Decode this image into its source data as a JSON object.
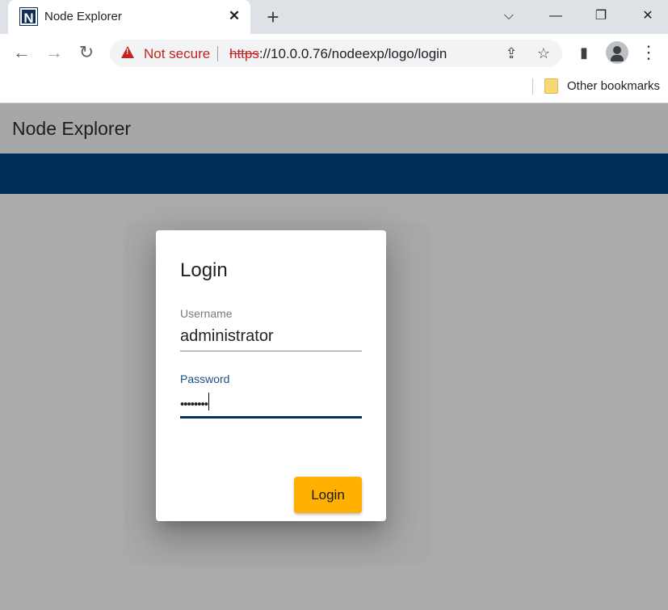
{
  "browser": {
    "tab_title": "Node Explorer",
    "favicon_letter": "N",
    "tab_close": "✕",
    "new_tab": "+",
    "security_label": "Not secure",
    "url_scheme": "https",
    "url_rest": "://10.0.0.76/nodeexp/logo/login",
    "bookmark_label": "Other bookmarks"
  },
  "icons": {
    "back": "←",
    "forward": "→",
    "reload": "↻",
    "share": "⇪",
    "star": "☆",
    "sidepanel": "▮",
    "menu": "⋮",
    "tab_search": "⌵",
    "minimize": "—",
    "restore": "❐",
    "close": "✕"
  },
  "app": {
    "title": "Node Explorer"
  },
  "login": {
    "title": "Login",
    "username_label": "Username",
    "username_value": "administrator",
    "password_label": "Password",
    "password_mask": "••••••••",
    "submit_label": "Login"
  },
  "colors": {
    "app_bar": "#002e5a",
    "accent_blue": "#1f4e87",
    "button": "#ffb000",
    "warning": "#c5221f"
  }
}
